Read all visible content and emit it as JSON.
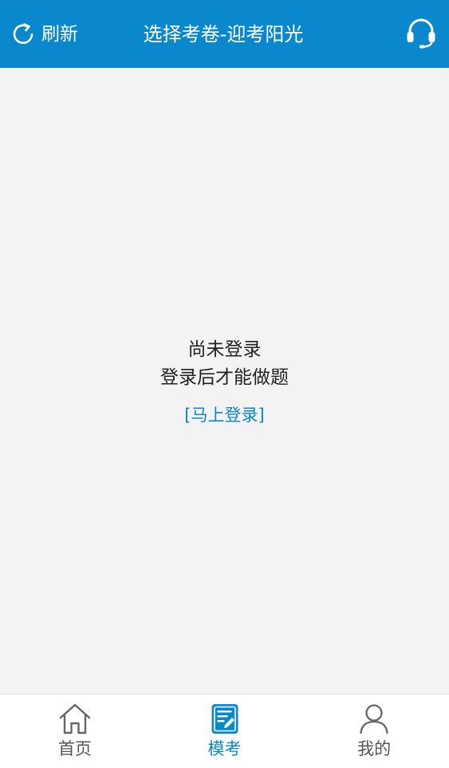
{
  "header": {
    "refresh_label": "刷新",
    "refresh_icon": "refresh-icon",
    "title": "选择考卷-迎考阳光",
    "support_icon": "headset-icon"
  },
  "main": {
    "notice_line1": "尚未登录",
    "notice_line2": "登录后才能做题",
    "login_link": "[马上登录]"
  },
  "bottom_nav": {
    "items": [
      {
        "label": "首页",
        "icon": "home-icon",
        "active": false
      },
      {
        "label": "模考",
        "icon": "exam-icon",
        "active": true
      },
      {
        "label": "我的",
        "icon": "user-icon",
        "active": false
      }
    ]
  },
  "colors": {
    "primary": "#0a88cd",
    "background": "#f3f3f3",
    "nav_inactive": "#555555",
    "text": "#222222"
  }
}
